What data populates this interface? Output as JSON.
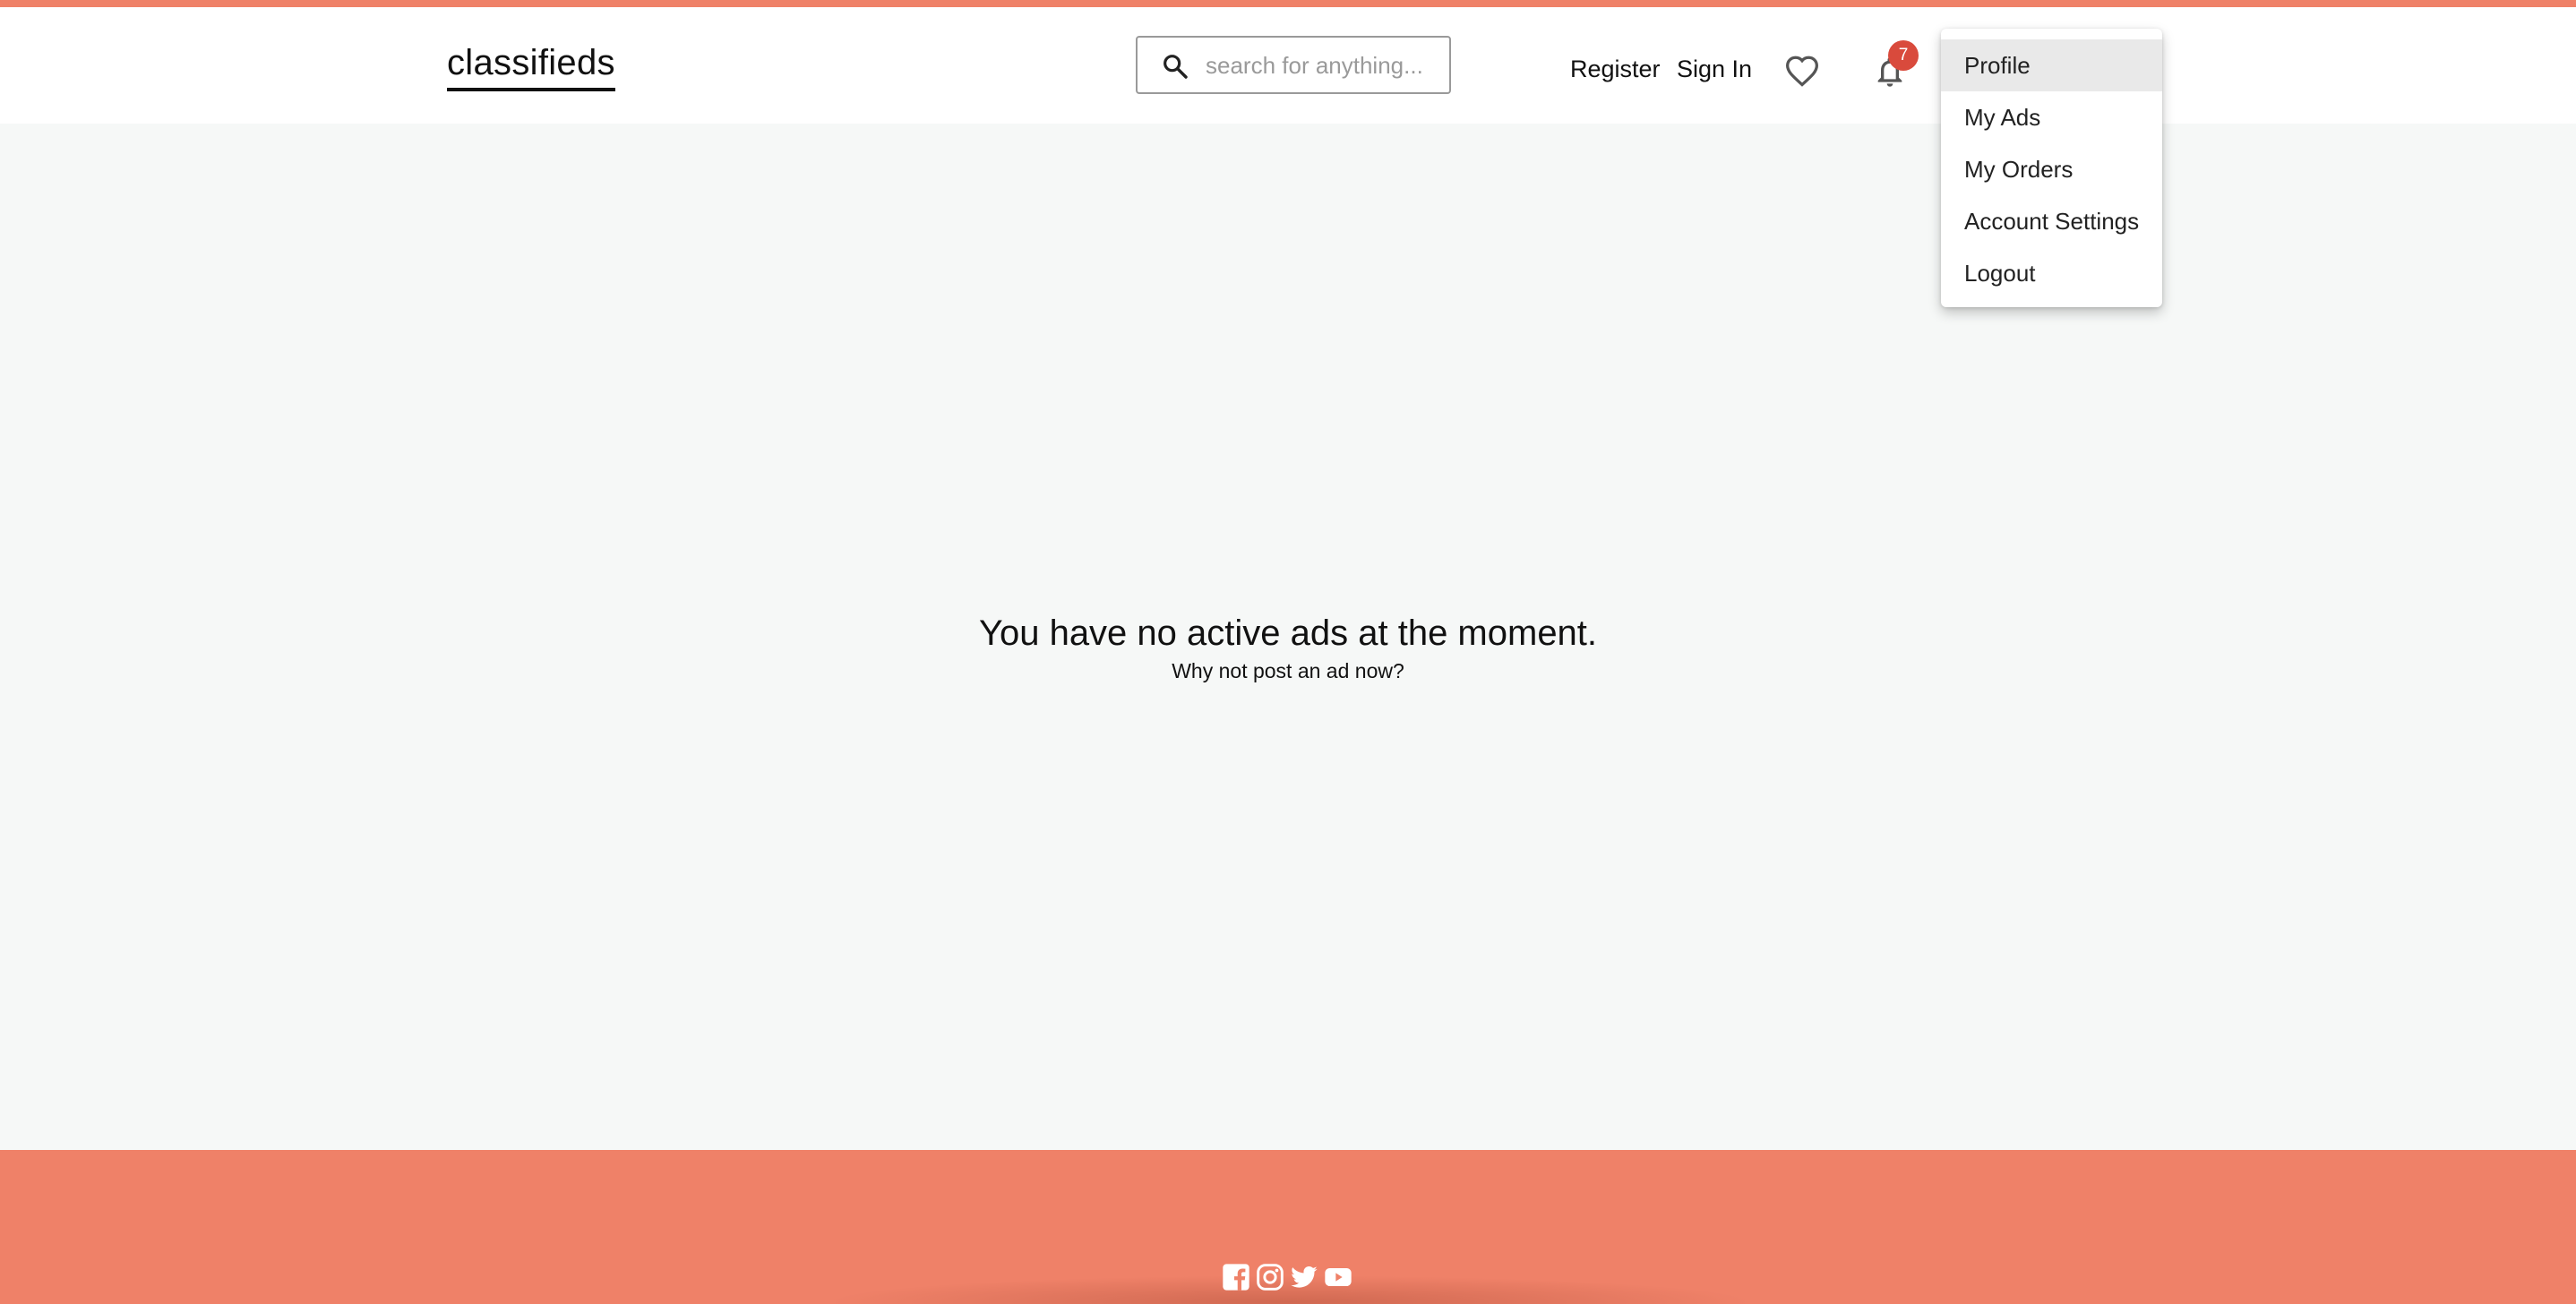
{
  "header": {
    "logo": "classifieds",
    "search": {
      "placeholder": "search for anything...",
      "value": ""
    },
    "nav": {
      "register": "Register",
      "sign_in": "Sign In"
    },
    "notifications": {
      "count": "7"
    }
  },
  "user_menu": {
    "items": [
      {
        "label": "Profile",
        "active": true
      },
      {
        "label": "My Ads",
        "active": false
      },
      {
        "label": "My Orders",
        "active": false
      },
      {
        "label": "Account Settings",
        "active": false
      },
      {
        "label": "Logout",
        "active": false
      }
    ]
  },
  "main": {
    "headline": "You have no active ads at the moment.",
    "subtext": "Why not post an ad now?"
  },
  "footer": {
    "social_icons": [
      "facebook-icon",
      "instagram-icon",
      "twitter-icon",
      "youtube-icon"
    ]
  },
  "colors": {
    "accent": "#ef8168",
    "badge": "#d94a3c",
    "background": "#f6f8f7"
  }
}
